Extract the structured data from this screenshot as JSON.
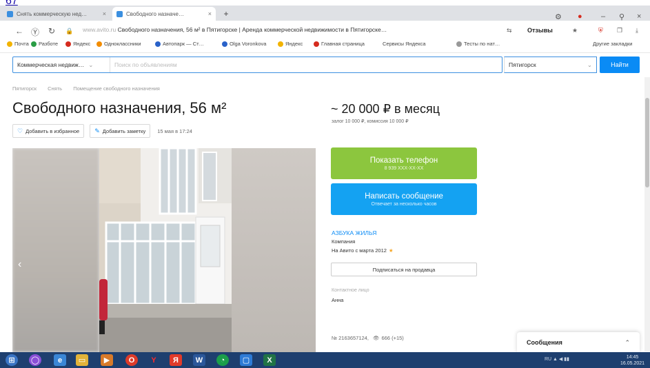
{
  "top_link": "67",
  "browser": {
    "tabs": [
      {
        "label": "Снять коммерческую нед…",
        "favicon_color": "#3b8fe0"
      },
      {
        "label": "Свободного назначе…",
        "favicon_color": "#3b8fe0"
      }
    ],
    "new_tab_glyph": "+",
    "url_host": "www.avito.ru",
    "page_title": "Свободного назначения, 56 м² в Пятигорске | Аренда коммерческой недвижимости в Пятигорске…",
    "reviews_label": "Отзывы",
    "bookmarks": [
      {
        "label": "Почта",
        "color": "#f2b300"
      },
      {
        "label": "Разботе",
        "color": "#2a9d45"
      },
      {
        "label": "Яндекс",
        "color": "#d52b1e"
      },
      {
        "label": "Одноклассники",
        "color": "#f28c00"
      },
      {
        "label": "Автопарк — Ст…",
        "color": "#2a62c9"
      },
      {
        "label": "Olga Voronkova",
        "color": "#2a62c9"
      },
      {
        "label": "Яндекс",
        "color": "#f2b300"
      },
      {
        "label": "Главная страница",
        "color": "#d52b1e"
      },
      {
        "label": "Сервисы Яндекса",
        "color": "#999999"
      },
      {
        "label": "Тесты по нат…",
        "color": "#999999"
      },
      {
        "label": "Другие закладки",
        "color": "#999999"
      }
    ]
  },
  "search": {
    "category": "Коммерческая недвиж…",
    "placeholder": "Поиск по объявлениям",
    "city": "Пятигорск",
    "find_label": "Найти"
  },
  "listing": {
    "breadcrumb": [
      "Пятигорск",
      "Снять",
      "Помещение свободного назначения"
    ],
    "title": "Свободного назначения, 56 м²",
    "add_favorite": "Добавить в избранное",
    "add_note": "Добавить заметку",
    "posted": "15 мая в 17:24",
    "price": "~ 20 000 ₽ в месяц",
    "deposit": "залог 10 000 ₽, комиссия 10 000 ₽",
    "show_phone": "Показать телефон",
    "phone_masked": "8 939 XXX-XX-XX",
    "write_message": "Написать сообщение",
    "reply_time": "Отвечает за несколько часов",
    "seller_name": "АЗБУКА ЖИЛЬЯ",
    "seller_type": "Компания",
    "seller_since": "На Авито с марта 2012",
    "subscribe_label": "Подписаться на продавца",
    "contact_label": "Контактное лицо",
    "contact_name": "Анна",
    "ad_number": "№ 2163657124,",
    "views": "666 (+15)"
  },
  "messages_panel": {
    "label": "Сообщения"
  },
  "taskbar": {
    "clock_time": "14:45",
    "clock_date": "16.05.2021"
  }
}
